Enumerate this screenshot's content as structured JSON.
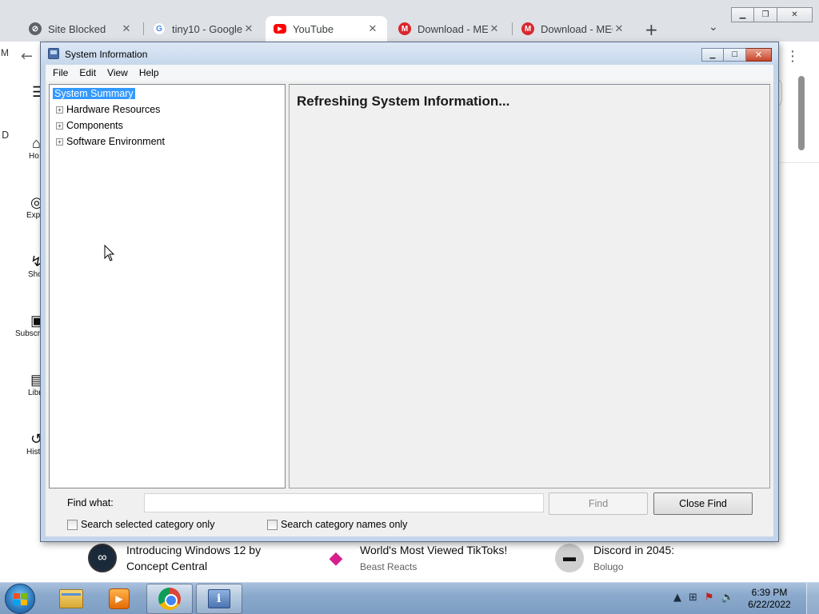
{
  "chrome": {
    "tabs": [
      {
        "title": "Site Blocked",
        "icon": "site-blocked-icon",
        "active": false
      },
      {
        "title": "tiny10 - Google",
        "icon": "google-icon",
        "active": false
      },
      {
        "title": "YouTube",
        "icon": "youtube-icon",
        "active": true
      },
      {
        "title": "Download - MEG",
        "icon": "mega-icon",
        "active": false
      },
      {
        "title": "Download - MEG",
        "icon": "mega-icon",
        "active": false
      }
    ],
    "partial_left_letter_top": "M",
    "partial_left_letter_mid": "D"
  },
  "youtube": {
    "sidebar": [
      {
        "label": "Ho",
        "icon": "home-icon"
      },
      {
        "label": "Exp",
        "icon": "explore-icon"
      },
      {
        "label": "Sho",
        "icon": "shorts-icon"
      },
      {
        "label": "Subscr",
        "icon": "subscriptions-icon"
      },
      {
        "label": "Libr",
        "icon": "library-icon"
      },
      {
        "label": "Hist",
        "icon": "history-icon"
      }
    ],
    "cards": [
      {
        "title_line1": "Introducing Windows 12 by",
        "title_line2": "Concept Central",
        "sub": ""
      },
      {
        "title_line1": "World's Most Viewed TikToks!",
        "title_line2": "",
        "sub": "Beast Reacts"
      },
      {
        "title_line1": "Discord in 2045:",
        "title_line2": "",
        "sub": "Bolugo"
      }
    ]
  },
  "msinfo": {
    "title": "System Information",
    "menu": [
      "File",
      "Edit",
      "View",
      "Help"
    ],
    "tree": {
      "root": "System Summary",
      "children": [
        "Hardware Resources",
        "Components",
        "Software Environment"
      ]
    },
    "status_text": "Refreshing System Information...",
    "find": {
      "label": "Find what:",
      "value": "",
      "find_button": "Find",
      "close_find_button": "Close Find",
      "check_selected_category": "Search selected category only",
      "check_category_names": "Search category names only"
    }
  },
  "taskbar": {
    "time": "6:39 PM",
    "date": "6/22/2022",
    "apps": [
      "windows-explorer-icon",
      "media-player-icon",
      "chrome-icon",
      "system-information-icon"
    ]
  }
}
